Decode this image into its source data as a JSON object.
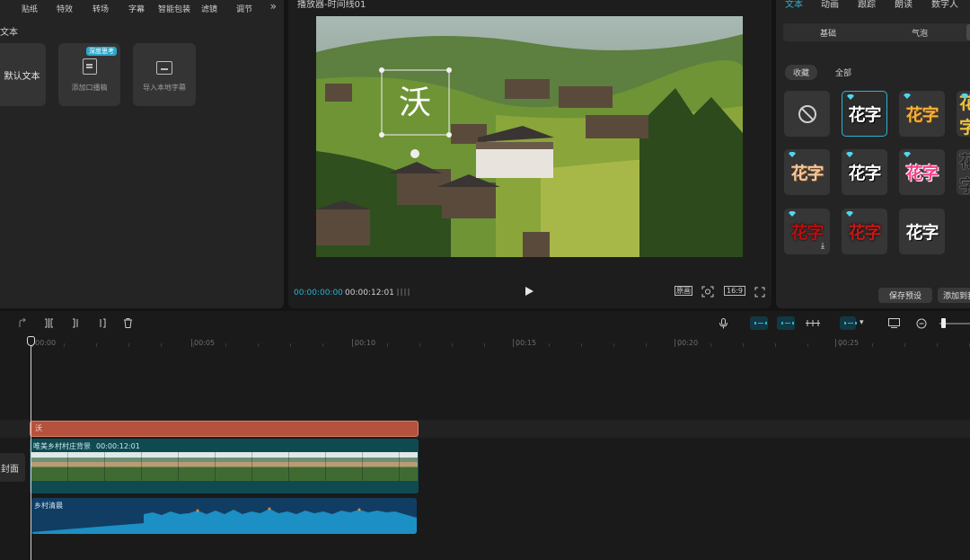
{
  "top_tabs": [
    "贴纸",
    "特效",
    "转场",
    "字幕",
    "智能包装",
    "滤镜",
    "调节"
  ],
  "top_tabs_more": "»",
  "left": {
    "section_title": "文本",
    "cards": {
      "default_text": "默认文本",
      "voice_label": "添加口播稿",
      "voice_badge": "深度思考",
      "local_label": "导入本地字幕"
    }
  },
  "player": {
    "title": "播放器-时间线01",
    "menu": "—",
    "overlay_char": "沃",
    "time_current": "00:00:00:00",
    "time_total": "00:00:12:01",
    "full_label": "原画",
    "ratio_label": "16:9"
  },
  "right": {
    "tabs": [
      "文本",
      "动画",
      "跟踪",
      "朗读",
      "数字人"
    ],
    "active_tab": 0,
    "segments": [
      "基础",
      "气泡"
    ],
    "chips": [
      "收藏",
      "全部"
    ],
    "style_text": "花字",
    "buttons": {
      "save_preset": "保存预设",
      "add_to": "添加到我的"
    },
    "colors": {
      "accent": "#27b3d1"
    }
  },
  "timeline": {
    "ruler_labels": [
      "00:00",
      "00:05",
      "00:10",
      "00:15",
      "00:20",
      "00:25"
    ],
    "text_clip_label": "沃",
    "cover_label": "封面",
    "video_clip": {
      "name": "唯美乡村村庄背景",
      "duration": "00:00:12:01"
    },
    "audio_clip": {
      "name": "乡村清晨"
    },
    "icons": [
      "redo-icon",
      "split-icon",
      "trim-left-icon",
      "trim-right-icon",
      "delete-icon",
      "mic-icon",
      "link-icon",
      "magnet-icon",
      "preview-axis-icon",
      "snap-icon",
      "zoom-out-icon"
    ]
  }
}
